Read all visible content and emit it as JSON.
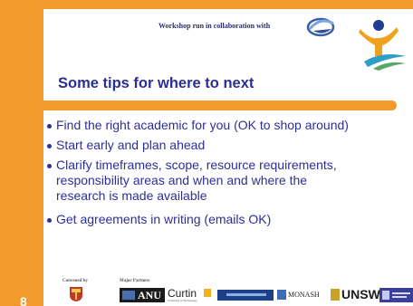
{
  "slide": {
    "collab_text": "Workshop run in collaboration with",
    "title": "Some tips for where to next",
    "bullets": [
      "Find the right academic for you (OK to shop around)",
      "Start early and plan ahead",
      "Clarify timeframes, scope, resource requirements,",
      "responsibility areas and when and where the",
      "research is made available",
      "Get agreements in writing (emails OK)"
    ],
    "footer": {
      "convened_label": "Convened by",
      "partners_label": "Major Partners",
      "page_number": "8",
      "partners": {
        "anu": "ANU",
        "curtin": "Curtin",
        "curtin_sub": "University of Technology",
        "monash": "MONASH",
        "unsw": "UNSW"
      }
    },
    "colors": {
      "accent": "#f39a2c",
      "text": "#2d2f9a",
      "title": "#2b2f93"
    },
    "icons": {
      "collaboration_logo": "swoosh-logo",
      "right_logo": "figure-logo",
      "convener_crest": "university-crest"
    }
  }
}
